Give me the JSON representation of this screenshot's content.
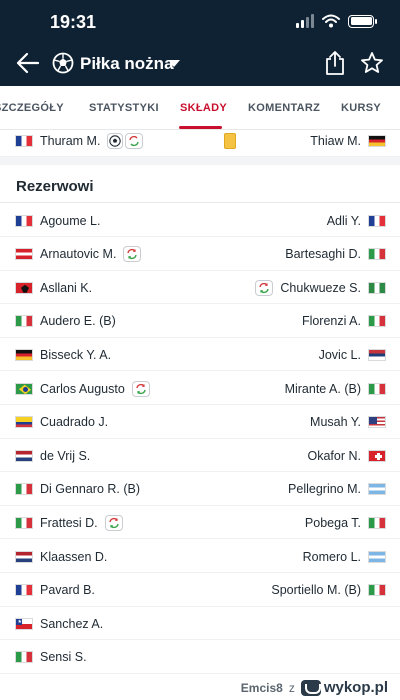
{
  "status_bar": {
    "time": "19:31"
  },
  "header": {
    "title": "Piłka nożna"
  },
  "tabs": [
    {
      "label": "SZCZEGÓŁY",
      "active": false
    },
    {
      "label": "STATYSTYKI",
      "active": false
    },
    {
      "label": "SKŁADY",
      "active": true
    },
    {
      "label": "KOMENTARZ",
      "active": false
    },
    {
      "label": "KURSY",
      "active": false
    }
  ],
  "top_row": {
    "left": {
      "name": "Thuram M.",
      "flag": "france",
      "icons": [
        "ball-icon",
        "substitution-icon"
      ]
    },
    "right": {
      "name": "Thiaw M.",
      "flag": "germany",
      "icons": [
        "yellow-card-icon"
      ]
    }
  },
  "reserves": {
    "title": "Rezerwowi",
    "rows": [
      {
        "left": {
          "name": "Agoume L.",
          "flag": "france",
          "sub": false
        },
        "right": {
          "name": "Adli Y.",
          "flag": "france",
          "sub": false
        }
      },
      {
        "left": {
          "name": "Arnautovic M.",
          "flag": "austria",
          "sub": true
        },
        "right": {
          "name": "Bartesaghi D.",
          "flag": "italy",
          "sub": false
        }
      },
      {
        "left": {
          "name": "Asllani K.",
          "flag": "albania",
          "sub": false
        },
        "right": {
          "name": "Chukwueze S.",
          "flag": "nigeria",
          "sub": true
        }
      },
      {
        "left": {
          "name": "Audero E. (B)",
          "flag": "italy",
          "sub": false
        },
        "right": {
          "name": "Florenzi A.",
          "flag": "italy",
          "sub": false
        }
      },
      {
        "left": {
          "name": "Bisseck Y. A.",
          "flag": "germany",
          "sub": false
        },
        "right": {
          "name": "Jovic L.",
          "flag": "serbia",
          "sub": false
        }
      },
      {
        "left": {
          "name": "Carlos Augusto",
          "flag": "brazil",
          "sub": true
        },
        "right": {
          "name": "Mirante A. (B)",
          "flag": "italy",
          "sub": false
        }
      },
      {
        "left": {
          "name": "Cuadrado J.",
          "flag": "colombia",
          "sub": false
        },
        "right": {
          "name": "Musah Y.",
          "flag": "usa",
          "sub": false
        }
      },
      {
        "left": {
          "name": "de Vrij S.",
          "flag": "netherlands",
          "sub": false
        },
        "right": {
          "name": "Okafor N.",
          "flag": "switzerland",
          "sub": false
        }
      },
      {
        "left": {
          "name": "Di Gennaro R. (B)",
          "flag": "italy",
          "sub": false
        },
        "right": {
          "name": "Pellegrino M.",
          "flag": "argentina",
          "sub": false
        }
      },
      {
        "left": {
          "name": "Frattesi D.",
          "flag": "italy",
          "sub": true
        },
        "right": {
          "name": "Pobega T.",
          "flag": "italy",
          "sub": false
        }
      },
      {
        "left": {
          "name": "Klaassen D.",
          "flag": "netherlands",
          "sub": false
        },
        "right": {
          "name": "Romero L.",
          "flag": "argentina",
          "sub": false
        }
      },
      {
        "left": {
          "name": "Pavard B.",
          "flag": "france",
          "sub": false
        },
        "right": {
          "name": "Sportiello M. (B)",
          "flag": "italy",
          "sub": false
        }
      },
      {
        "left": {
          "name": "Sanchez A.",
          "flag": "chile",
          "sub": false
        },
        "right": null
      },
      {
        "left": {
          "name": "Sensi S.",
          "flag": "italy",
          "sub": false
        },
        "right": null
      }
    ]
  },
  "footer": {
    "user": "Emcis8",
    "connector": "z",
    "site": "wykop.pl"
  },
  "colors": {
    "header_bg": "#0f2233",
    "accent": "#c8102e",
    "sub_green": "#3aa34a",
    "sub_red": "#d23b3b"
  }
}
